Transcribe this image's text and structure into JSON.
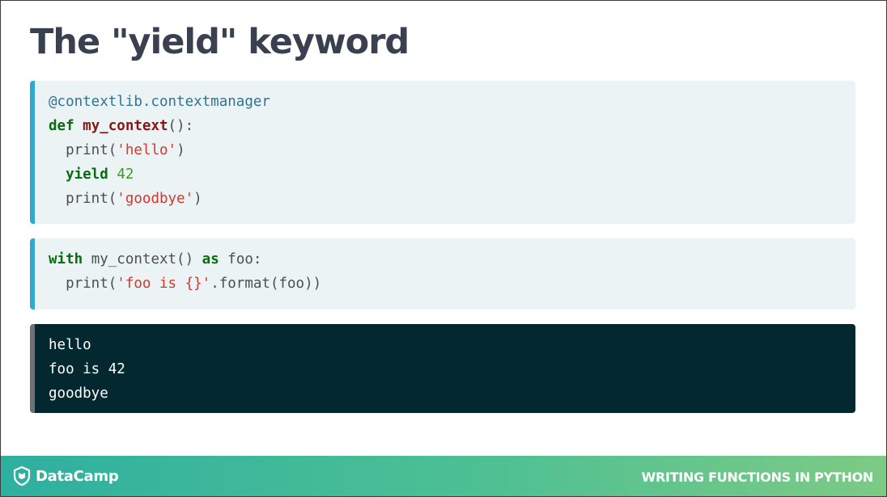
{
  "slide": {
    "title": "The \"yield\" keyword"
  },
  "code_block_1": {
    "line1": {
      "decorator": "@contextlib.contextmanager"
    },
    "line2": {
      "kw": "def",
      "sp": " ",
      "name": "my_context",
      "rest": "():"
    },
    "line3": {
      "indent": "  ",
      "call": "print(",
      "str": "'hello'",
      "close": ")"
    },
    "line4": {
      "indent": "  ",
      "kw": "yield",
      "sp": " ",
      "num": "42"
    },
    "line5": {
      "indent": "  ",
      "call": "print(",
      "str": "'goodbye'",
      "close": ")"
    }
  },
  "code_block_2": {
    "line1": {
      "kw1": "with",
      "mid": " my_context() ",
      "kw2": "as",
      "rest": " foo:"
    },
    "line2": {
      "indent": "  ",
      "call": "print(",
      "str": "'foo is {}'",
      "rest": ".format(foo))"
    }
  },
  "output_block": {
    "lines": [
      "hello",
      "foo is 42",
      "goodbye"
    ]
  },
  "footer": {
    "brand": "DataCamp",
    "course": "WRITING FUNCTIONS IN PYTHON",
    "logo_icon": "datacamp-logo-icon"
  },
  "colors": {
    "keyword": "#0b6b12",
    "function_name": "#8a1616",
    "string": "#d5362f",
    "number": "#3e9a1a",
    "decorator": "#2f7395",
    "code_bg": "#ebf3f5",
    "code_border": "#30a8d0",
    "output_bg": "#03282f",
    "footer_gradient_start": "#2eb0a0",
    "footer_gradient_end": "#7dca85"
  }
}
